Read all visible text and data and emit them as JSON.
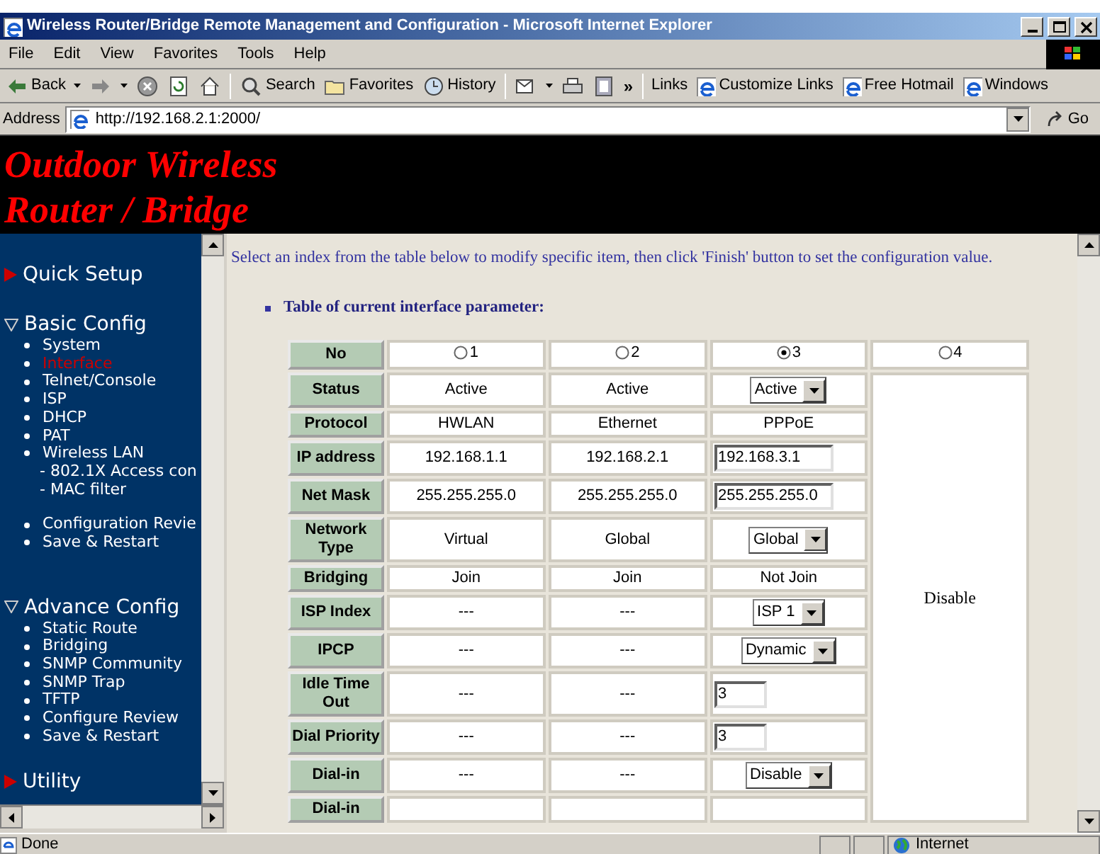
{
  "window": {
    "title": "Wireless Router/Bridge Remote Management and Configuration - Microsoft Internet Explorer"
  },
  "menu": [
    "File",
    "Edit",
    "View",
    "Favorites",
    "Tools",
    "Help"
  ],
  "toolbar": {
    "buttons": [
      {
        "kind": "back",
        "label": "Back"
      },
      {
        "kind": "forward"
      },
      {
        "kind": "stop"
      },
      {
        "kind": "refresh"
      },
      {
        "kind": "home"
      },
      {
        "kind": "search",
        "label": "Search"
      },
      {
        "kind": "favorites",
        "label": "Favorites"
      },
      {
        "kind": "history",
        "label": "History"
      },
      {
        "kind": "mail"
      },
      {
        "kind": "print"
      },
      {
        "kind": "edit"
      }
    ],
    "overflow": "»",
    "links_label": "Links",
    "links": [
      "Customize Links",
      "Free Hotmail",
      "Windows"
    ]
  },
  "address_bar": {
    "label": "Address",
    "value": "http://192.168.2.1:2000/",
    "go": "Go"
  },
  "banner": {
    "lines": [
      "Outdoor Wireless",
      "Router / Bridge"
    ]
  },
  "sidebar": {
    "sections": [
      {
        "title": "Quick Setup",
        "expanded": false
      },
      {
        "title": "Basic Config",
        "expanded": true,
        "items": [
          {
            "kind": "bullet",
            "label": "System",
            "selected": false
          },
          {
            "kind": "bullet",
            "label": "Interface",
            "selected": true
          },
          {
            "kind": "bullet",
            "label": "Telnet/Console",
            "selected": false
          },
          {
            "kind": "bullet",
            "label": "ISP",
            "selected": false
          },
          {
            "kind": "bullet",
            "label": "DHCP",
            "selected": false
          },
          {
            "kind": "bullet",
            "label": "PAT",
            "selected": false
          },
          {
            "kind": "bullet",
            "label": "Wireless LAN",
            "selected": false
          },
          {
            "kind": "sub",
            "label": "- 802.1X Access con",
            "selected": false
          },
          {
            "kind": "sub",
            "label": "- MAC filter",
            "selected": false
          },
          {
            "kind": "gap"
          },
          {
            "kind": "bullet",
            "label": "Configuration Revie",
            "selected": false
          },
          {
            "kind": "bullet",
            "label": "Save & Restart",
            "selected": false
          }
        ]
      },
      {
        "title": "Advance Config",
        "expanded": true,
        "items": [
          {
            "kind": "bullet",
            "label": "Static Route",
            "selected": false
          },
          {
            "kind": "bullet",
            "label": "Bridging",
            "selected": false
          },
          {
            "kind": "bullet",
            "label": "SNMP Community",
            "selected": false
          },
          {
            "kind": "bullet",
            "label": "SNMP Trap",
            "selected": false
          },
          {
            "kind": "bullet",
            "label": "TFTP",
            "selected": false
          },
          {
            "kind": "bullet",
            "label": "Configure Review",
            "selected": false
          },
          {
            "kind": "bullet",
            "label": "Save & Restart",
            "selected": false
          }
        ]
      },
      {
        "title": "Utility",
        "expanded": false
      }
    ]
  },
  "content": {
    "instruction": "Select an index from the table below to modify specific item, then click 'Finish' button to set the configuration value.",
    "table_title": "Table of current interface parameter:",
    "table": {
      "header": "No",
      "columns": [
        {
          "label": "1",
          "selected": false
        },
        {
          "label": "2",
          "selected": false
        },
        {
          "label": "3",
          "selected": true
        },
        {
          "label": "4",
          "selected": false
        }
      ],
      "column_4_note": "Disable",
      "rows": [
        {
          "label": "Status",
          "cells": [
            {
              "kind": "text",
              "value": "Active"
            },
            {
              "kind": "text",
              "value": "Active"
            },
            {
              "kind": "select",
              "value": "Active"
            }
          ]
        },
        {
          "label": "Protocol",
          "cells": [
            {
              "kind": "text",
              "value": "HWLAN"
            },
            {
              "kind": "text",
              "value": "Ethernet"
            },
            {
              "kind": "text",
              "value": "PPPoE"
            }
          ]
        },
        {
          "label": "IP address",
          "cells": [
            {
              "kind": "text",
              "value": "192.168.1.1"
            },
            {
              "kind": "text",
              "value": "192.168.2.1"
            },
            {
              "kind": "input",
              "value": "192.168.3.1"
            }
          ]
        },
        {
          "label": "Net Mask",
          "cells": [
            {
              "kind": "text",
              "value": "255.255.255.0"
            },
            {
              "kind": "text",
              "value": "255.255.255.0"
            },
            {
              "kind": "input",
              "value": "255.255.255.0"
            }
          ]
        },
        {
          "label": "Network Type",
          "cells": [
            {
              "kind": "text",
              "value": "Virtual"
            },
            {
              "kind": "text",
              "value": "Global"
            },
            {
              "kind": "select",
              "value": "Global"
            }
          ]
        },
        {
          "label": "Bridging",
          "cells": [
            {
              "kind": "text",
              "value": "Join"
            },
            {
              "kind": "text",
              "value": "Join"
            },
            {
              "kind": "text",
              "value": "Not Join"
            }
          ]
        },
        {
          "label": "ISP Index",
          "cells": [
            {
              "kind": "text",
              "value": "---"
            },
            {
              "kind": "text",
              "value": "---"
            },
            {
              "kind": "select",
              "value": "ISP 1"
            }
          ]
        },
        {
          "label": "IPCP",
          "cells": [
            {
              "kind": "text",
              "value": "---"
            },
            {
              "kind": "text",
              "value": "---"
            },
            {
              "kind": "select",
              "value": "Dynamic"
            }
          ]
        },
        {
          "label": "Idle Time Out",
          "cells": [
            {
              "kind": "text",
              "value": "---"
            },
            {
              "kind": "text",
              "value": "---"
            },
            {
              "kind": "short_input",
              "value": "3"
            }
          ]
        },
        {
          "label": "Dial Priority",
          "cells": [
            {
              "kind": "text",
              "value": "---"
            },
            {
              "kind": "text",
              "value": "---"
            },
            {
              "kind": "short_input",
              "value": "3"
            }
          ]
        },
        {
          "label": "Dial-in",
          "cells": [
            {
              "kind": "text",
              "value": "---"
            },
            {
              "kind": "text",
              "value": "---"
            },
            {
              "kind": "select",
              "value": "Disable"
            }
          ]
        },
        {
          "label": "Dial-in",
          "cells": [
            {
              "kind": "empty"
            },
            {
              "kind": "empty"
            },
            {
              "kind": "empty"
            }
          ]
        }
      ]
    }
  },
  "status_bar": {
    "text": "Done",
    "zone": "Internet"
  }
}
